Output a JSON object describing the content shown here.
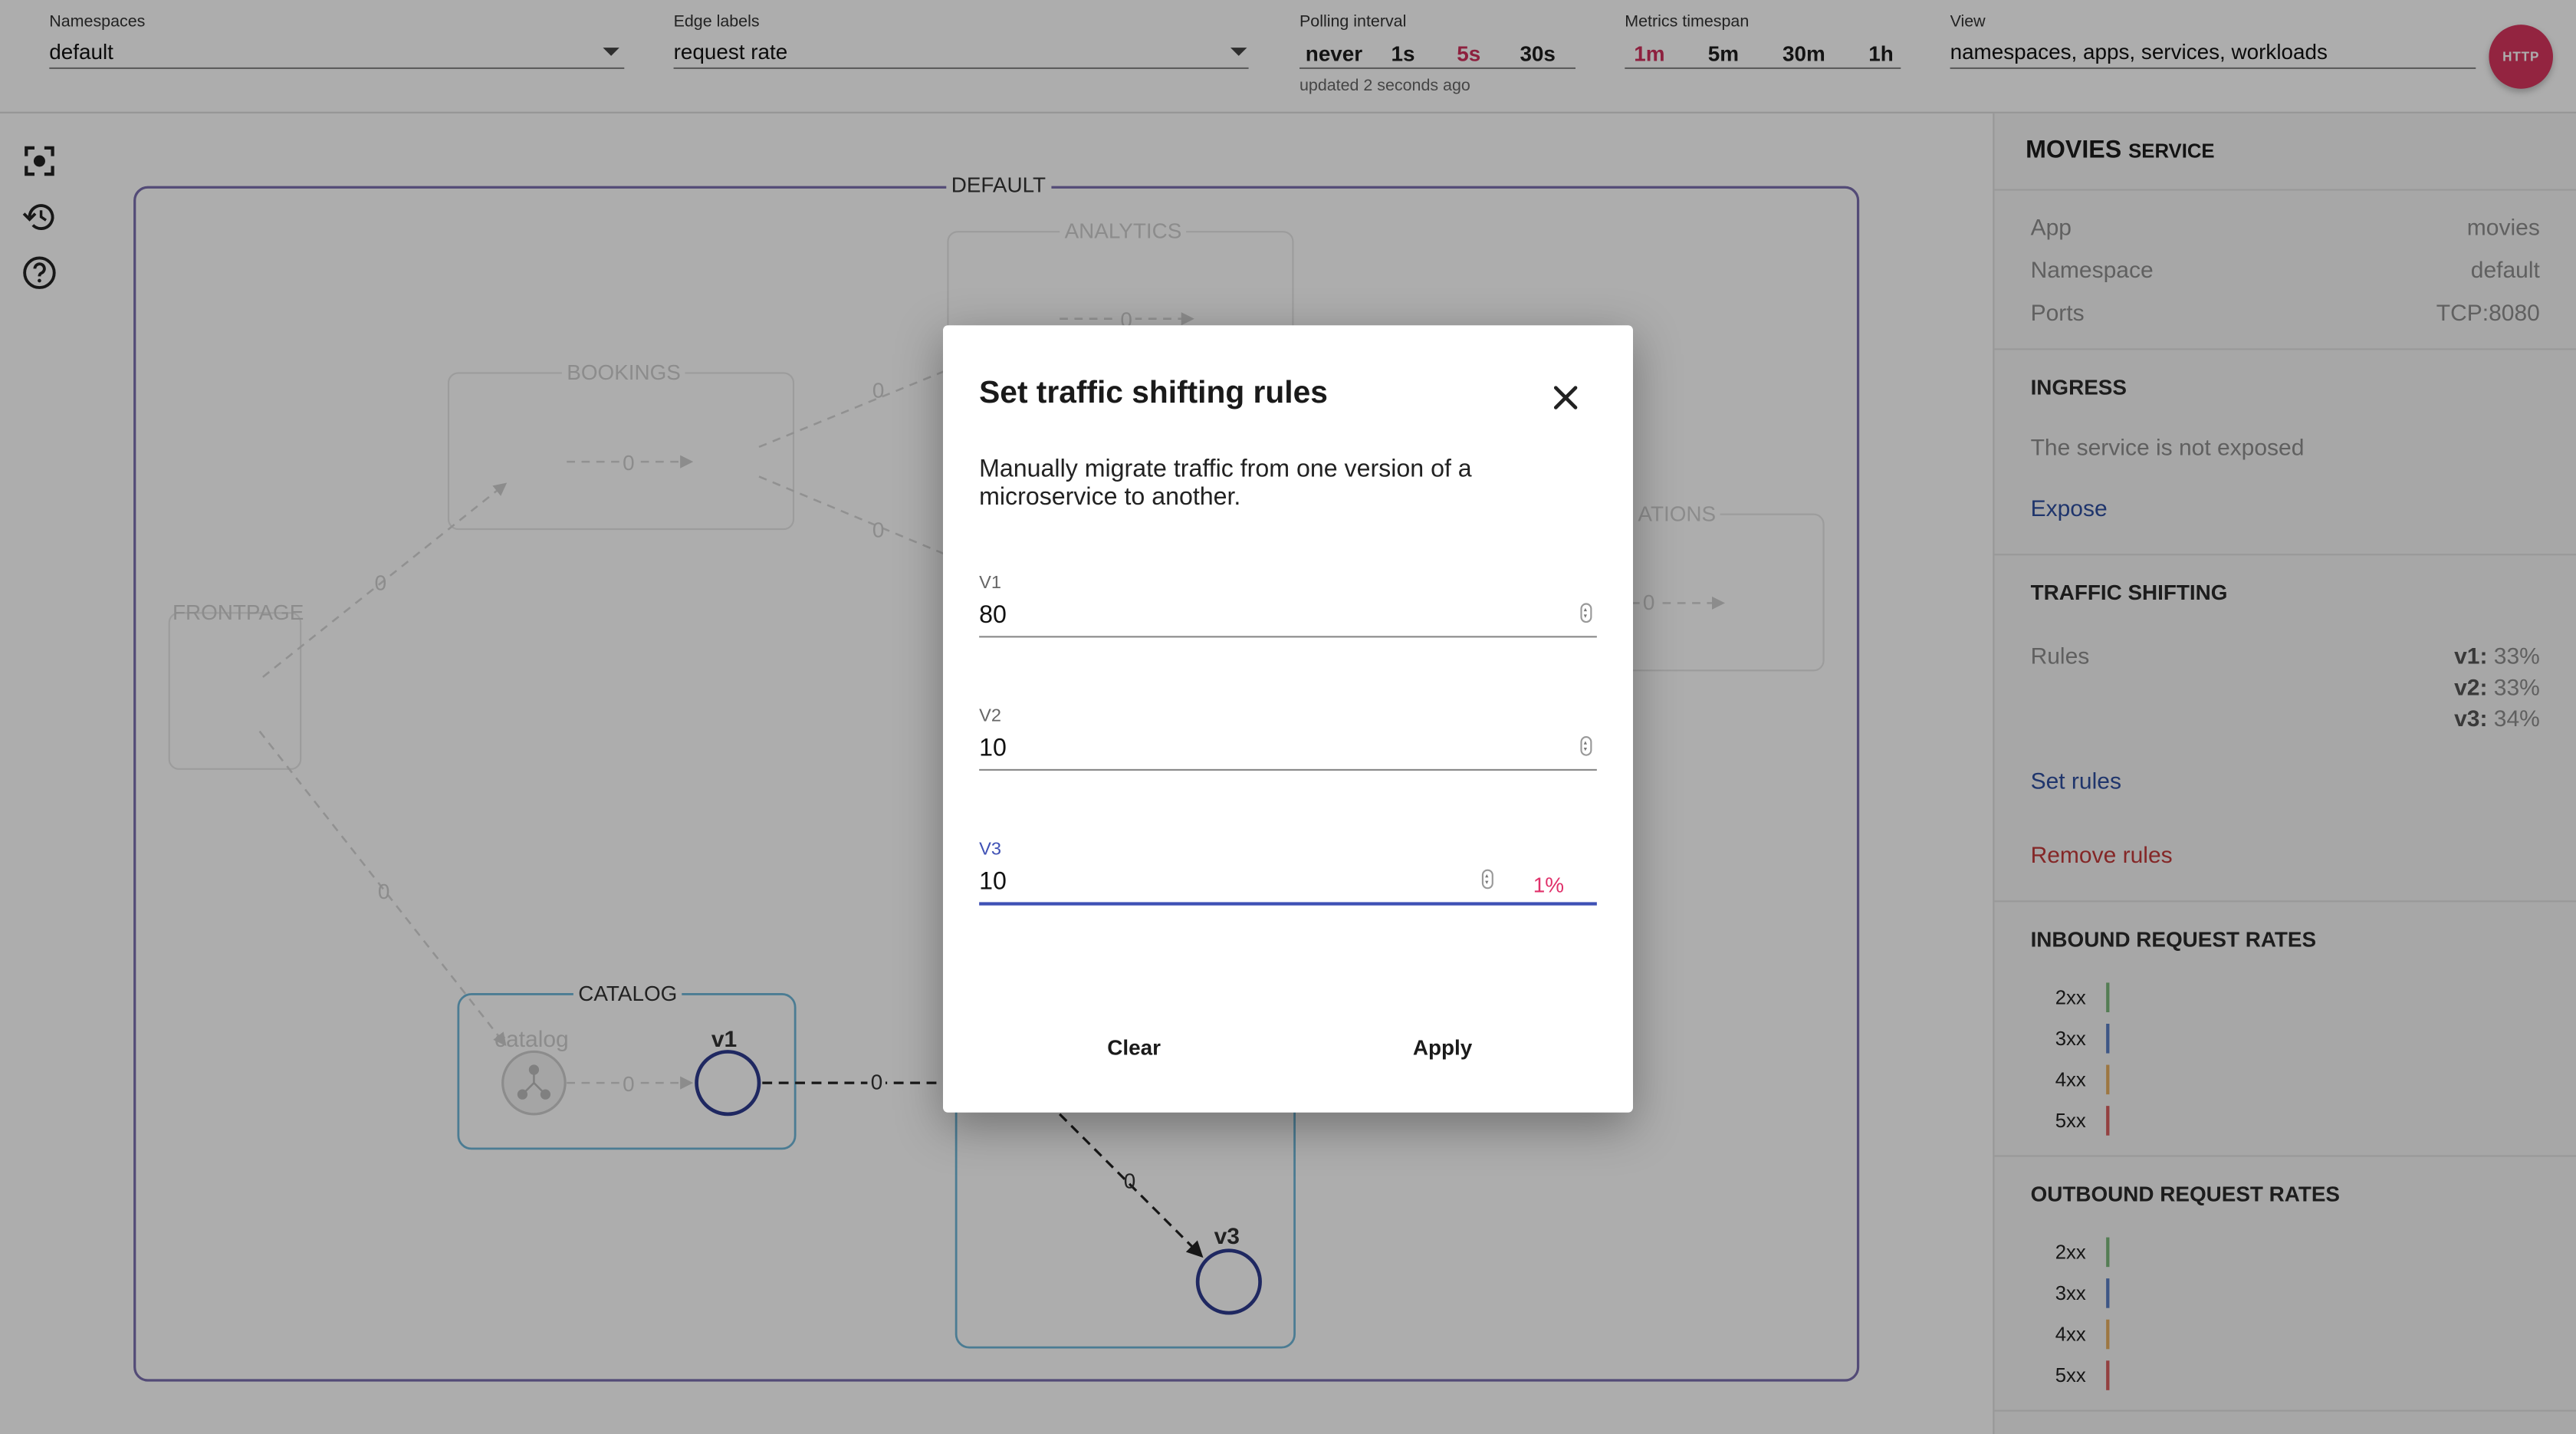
{
  "topbar": {
    "namespaces": {
      "label": "Namespaces",
      "value": "default"
    },
    "edge_labels": {
      "label": "Edge labels",
      "value": "request rate"
    },
    "polling": {
      "label": "Polling interval",
      "options": [
        "never",
        "1s",
        "5s",
        "30s"
      ],
      "selected": "5s",
      "note": "updated 2 seconds ago"
    },
    "metrics": {
      "label": "Metrics timespan",
      "options": [
        "1m",
        "5m",
        "30m",
        "1h"
      ],
      "selected": "1m"
    },
    "view": {
      "label": "View",
      "value": "namespaces, apps, services, workloads"
    },
    "http_label": "HTTP"
  },
  "graph": {
    "namespace_label": "DEFAULT",
    "apps": {
      "analytics": "ANALYTICS",
      "bookings": "BOOKINGS",
      "frontpage": "FRONTPAGE",
      "notifications": "ATIONS",
      "catalog": "CATALOG",
      "catalog_service": "catalog"
    },
    "versions": {
      "catalog_v1": "v1",
      "movies_v3": "v3"
    },
    "edge_value": "0"
  },
  "panel": {
    "title": "MOVIES",
    "subtitle": "SERVICE",
    "details": [
      {
        "key": "App",
        "value": "movies"
      },
      {
        "key": "Namespace",
        "value": "default"
      },
      {
        "key": "Ports",
        "value": "TCP:8080"
      }
    ],
    "ingress": {
      "heading": "INGRESS",
      "status": "The service is not exposed",
      "action": "Expose"
    },
    "traffic_shifting": {
      "heading": "TRAFFIC SHIFTING",
      "rules_label": "Rules",
      "rules": [
        {
          "version": "v1:",
          "percent": "33%"
        },
        {
          "version": "v2:",
          "percent": "33%"
        },
        {
          "version": "v3:",
          "percent": "34%"
        }
      ],
      "set_action": "Set rules",
      "remove_action": "Remove rules"
    },
    "inbound": {
      "heading": "INBOUND REQUEST RATES",
      "codes": [
        "2xx",
        "3xx",
        "4xx",
        "5xx"
      ]
    },
    "outbound": {
      "heading": "OUTBOUND REQUEST RATES",
      "codes": [
        "2xx",
        "3xx",
        "4xx",
        "5xx"
      ]
    },
    "colors": {
      "2xx": "#7cb87c",
      "3xx": "#5b7fc4",
      "4xx": "#e8b061",
      "5xx": "#d95f5f"
    }
  },
  "dialog": {
    "title": "Set traffic shifting rules",
    "description": "Manually migrate traffic from one version of a microservice to another.",
    "fields": [
      {
        "label": "V1",
        "value": "80"
      },
      {
        "label": "V2",
        "value": "10"
      },
      {
        "label": "V3",
        "value": "10",
        "remaining": "1%"
      }
    ],
    "clear_label": "Clear",
    "apply_label": "Apply"
  },
  "colors": {
    "accent": "#d0305c",
    "link": "#2f4fa0",
    "danger": "#c33a3a",
    "focus": "#3f51b5",
    "node": "#2f3b8f",
    "namespace_border": "#7b6fb0",
    "app_border": "#6fb7d9"
  }
}
